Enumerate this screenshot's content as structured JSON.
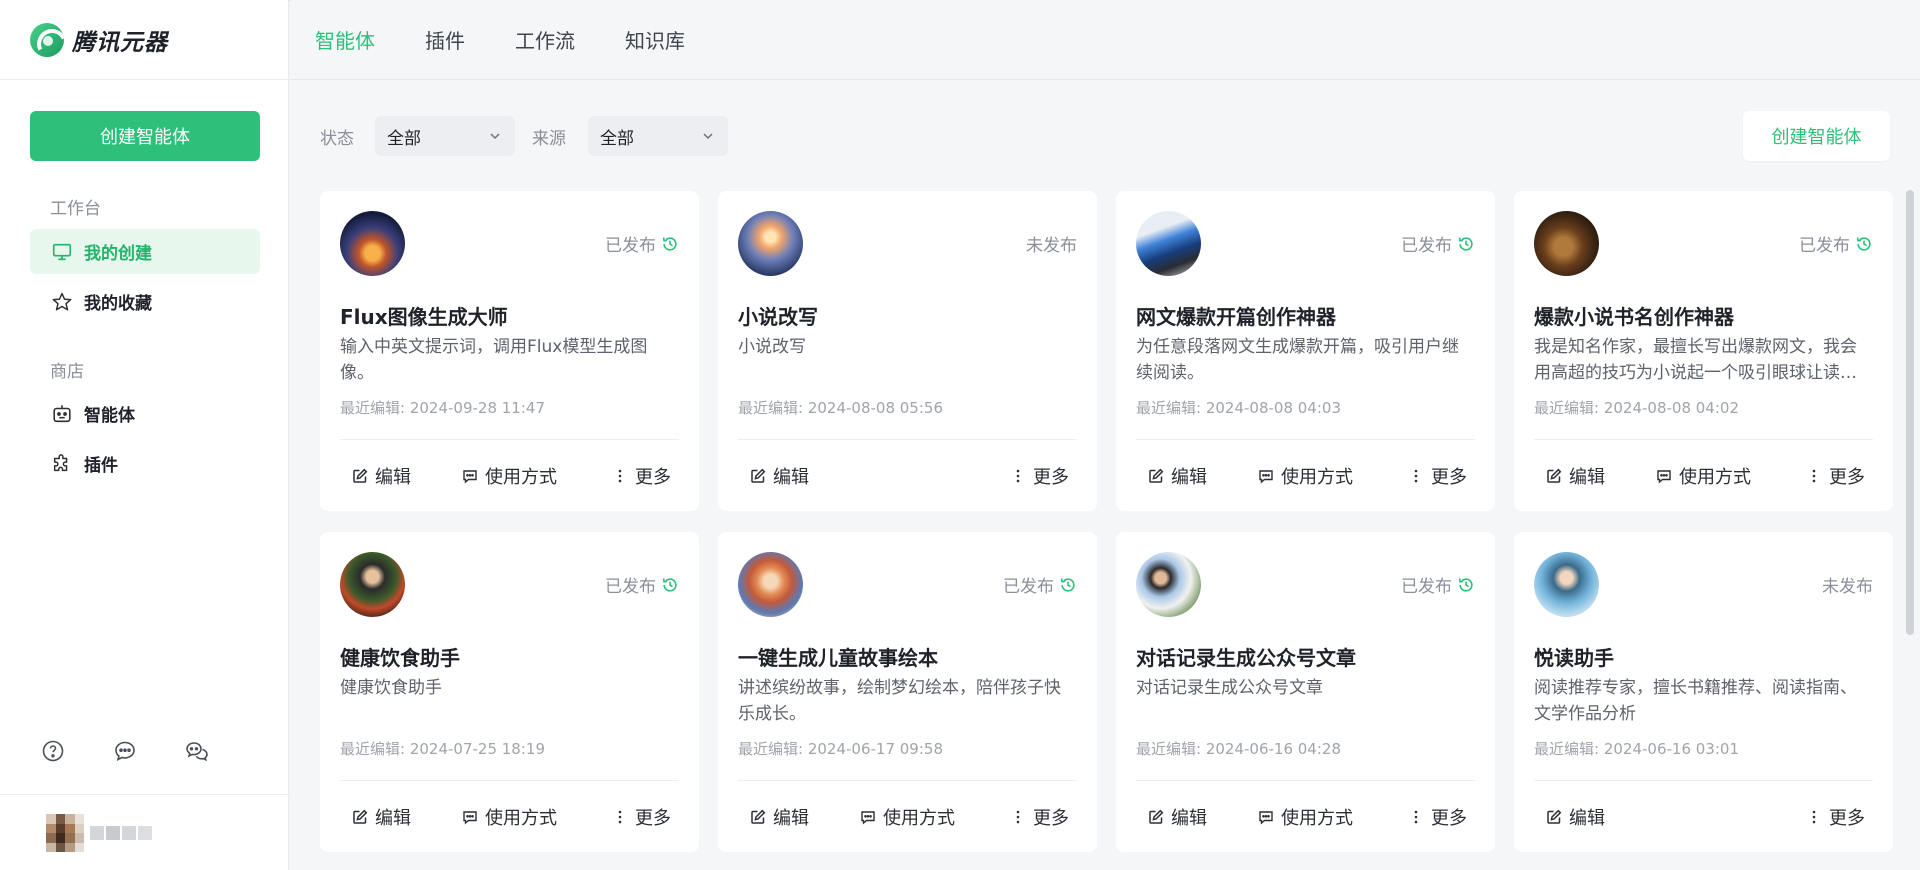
{
  "brand": {
    "name": "腾讯元器",
    "accent": "#2dc07a"
  },
  "sidebar": {
    "create_button": "创建智能体",
    "workspace_label": "工作台",
    "workspace_items": [
      {
        "label": "我的创建",
        "icon": "monitor-icon",
        "active": true
      },
      {
        "label": "我的收藏",
        "icon": "star-icon",
        "active": false
      }
    ],
    "store_label": "商店",
    "store_items": [
      {
        "label": "智能体",
        "icon": "robot-icon"
      },
      {
        "label": "插件",
        "icon": "puzzle-icon"
      }
    ],
    "bottom_icons": [
      "help-icon",
      "feedback-icon",
      "community-icon"
    ]
  },
  "topnav": {
    "tabs": [
      {
        "label": "智能体",
        "active": true
      },
      {
        "label": "插件",
        "active": false
      },
      {
        "label": "工作流",
        "active": false
      },
      {
        "label": "知识库",
        "active": false
      }
    ]
  },
  "filters": {
    "status_label": "状态",
    "status_value": "全部",
    "source_label": "来源",
    "source_value": "全部",
    "create_button": "创建智能体"
  },
  "actions": {
    "edit": "编辑",
    "usage": "使用方式",
    "more": "更多"
  },
  "cards": [
    {
      "title": "Flux图像生成大师",
      "desc": "输入中英文提示词，调用Flux模型生成图像。",
      "edited": "最近编辑: 2024-09-28 11:47",
      "status": "已发布",
      "published": true,
      "has_usage": true
    },
    {
      "title": "小说改写",
      "desc": "小说改写",
      "edited": "最近编辑: 2024-08-08 05:56",
      "status": "未发布",
      "published": false,
      "has_usage": false
    },
    {
      "title": "网文爆款开篇创作神器",
      "desc": "为任意段落网文生成爆款开篇，吸引用户继续阅读。",
      "edited": "最近编辑: 2024-08-08 04:03",
      "status": "已发布",
      "published": true,
      "has_usage": true
    },
    {
      "title": "爆款小说书名创作神器",
      "desc": "我是知名作家，最擅长写出爆款网文，我会用高超的技巧为小说起一个吸引眼球让读…",
      "edited": "最近编辑: 2024-08-08 04:02",
      "status": "已发布",
      "published": true,
      "has_usage": true
    },
    {
      "title": "健康饮食助手",
      "desc": "健康饮食助手",
      "edited": "最近编辑: 2024-07-25 18:19",
      "status": "已发布",
      "published": true,
      "has_usage": true
    },
    {
      "title": "一键生成儿童故事绘本",
      "desc": "讲述缤纷故事，绘制梦幻绘本，陪伴孩子快乐成长。",
      "edited": "最近编辑: 2024-06-17 09:58",
      "status": "已发布",
      "published": true,
      "has_usage": true
    },
    {
      "title": "对话记录生成公众号文章",
      "desc": "对话记录生成公众号文章",
      "edited": "最近编辑: 2024-06-16 04:28",
      "status": "已发布",
      "published": true,
      "has_usage": true
    },
    {
      "title": "悦读助手",
      "desc": "阅读推荐专家，擅长书籍推荐、阅读指南、文学作品分析",
      "edited": "最近编辑: 2024-06-16 03:01",
      "status": "未发布",
      "published": false,
      "has_usage": false
    }
  ]
}
